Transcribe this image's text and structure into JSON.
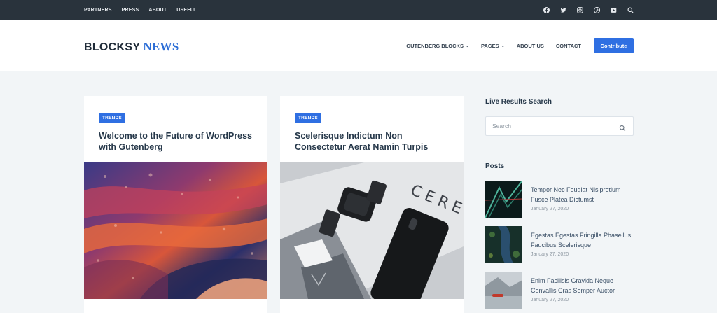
{
  "topbar": {
    "links": [
      "PARTNERS",
      "PRESS",
      "ABOUT",
      "USEFUL"
    ],
    "social_icons": [
      "facebook-icon",
      "twitter-icon",
      "instagram-icon",
      "pinterest-icon",
      "youtube-icon",
      "search-icon"
    ]
  },
  "header": {
    "logo_part1": "BLOCKSY",
    "logo_part2": "NEWS",
    "nav": [
      {
        "label": "GUTENBERG BLOCKS",
        "dropdown": true
      },
      {
        "label": "PAGES",
        "dropdown": true
      },
      {
        "label": "ABOUT US",
        "dropdown": false
      },
      {
        "label": "CONTACT",
        "dropdown": false
      }
    ],
    "cta_label": "Contribute"
  },
  "posts": [
    {
      "category": "TRENDS",
      "title": "Welcome to the Future of WordPress with Gutenberg"
    },
    {
      "category": "TRENDS",
      "title": "Scelerisque Indictum Non Consectetur Aerat Namin Turpis"
    }
  ],
  "sidebar": {
    "search_title": "Live Results Search",
    "search_placeholder": "Search",
    "posts_title": "Posts",
    "recent": [
      {
        "title": "Tempor Nec Feugiat Nislpretium Fusce Platea Dictumst",
        "date": "January 27, 2020"
      },
      {
        "title": "Egestas Egestas Fringilla Phasellus Faucibus Scelerisque",
        "date": "January 27, 2020"
      },
      {
        "title": "Enim Facilisis Gravida Neque Convallis Cras Semper Auctor",
        "date": "January 27, 2020"
      }
    ]
  },
  "colors": {
    "accent": "#2f6fe2",
    "topbar": "#29333c",
    "background": "#f2f5f7"
  }
}
